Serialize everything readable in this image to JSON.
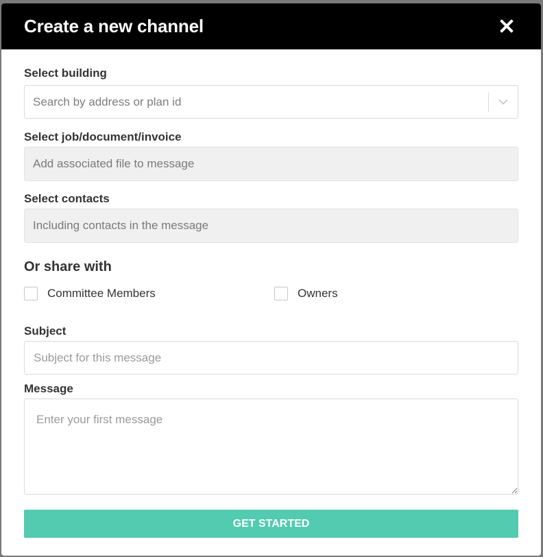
{
  "modal": {
    "title": "Create a new channel",
    "close_icon": "close-icon"
  },
  "building": {
    "label": "Select building",
    "placeholder": "Search by address or plan id",
    "icon": "chevron-down-icon"
  },
  "job": {
    "label": "Select job/document/invoice",
    "placeholder": "Add associated file to message"
  },
  "contacts": {
    "label": "Select contacts",
    "placeholder": "Including contacts in the message"
  },
  "share": {
    "heading": "Or share with",
    "options": [
      {
        "label": "Committee Members",
        "checked": false
      },
      {
        "label": "Owners",
        "checked": false
      }
    ]
  },
  "subject": {
    "label": "Subject",
    "placeholder": "Subject for this message",
    "value": ""
  },
  "message": {
    "label": "Message",
    "placeholder": "Enter your first message",
    "value": ""
  },
  "submit": {
    "label": "GET STARTED",
    "color": "#52cbb0"
  },
  "colors": {
    "header_bg": "#000000",
    "accent": "#52cbb0"
  }
}
